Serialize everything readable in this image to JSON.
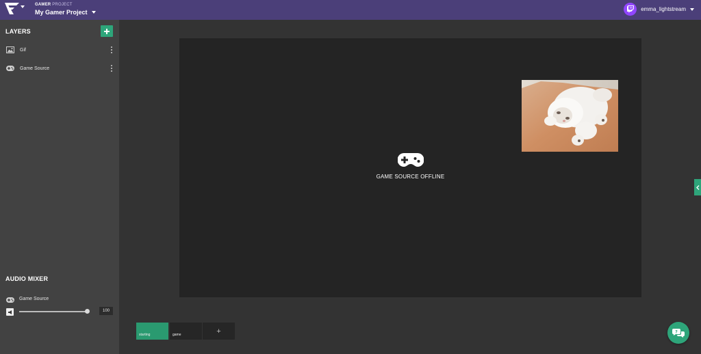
{
  "header": {
    "project_kicker_bold": "GAMER",
    "project_kicker_rest": " PROJECT",
    "project_name": "My Gamer Project",
    "username": "emma_lightstream",
    "icons": {
      "logo": "lightstream-logo-icon",
      "dropdown": "caret-down-icon",
      "avatar": "twitch-icon"
    }
  },
  "sidebar": {
    "layers_title": "LAYERS",
    "add_layer_icon": "plus-icon",
    "layers": [
      {
        "label": "Gif",
        "icon": "image-icon"
      },
      {
        "label": "Game Source",
        "icon": "gamepad-icon"
      }
    ],
    "audio_title": "AUDIO MIXER",
    "audio": {
      "source_label": "Game Source",
      "source_icon": "gamepad-icon",
      "mute_icon": "speaker-icon",
      "volume": 100
    }
  },
  "canvas": {
    "offline_label": "GAME SOURCE OFFLINE",
    "offline_icon": "gamepad-icon",
    "gif_subject": "cat"
  },
  "scenes": [
    {
      "label": "starting",
      "active": true
    },
    {
      "label": "game",
      "active": false
    }
  ],
  "add_scene_label": "+",
  "colors": {
    "topbar": "#4b3f79",
    "accent": "#2ea57a",
    "twitch": "#9146ff",
    "sidebar": "#424242",
    "workspace": "#333333",
    "canvas": "#242424"
  }
}
